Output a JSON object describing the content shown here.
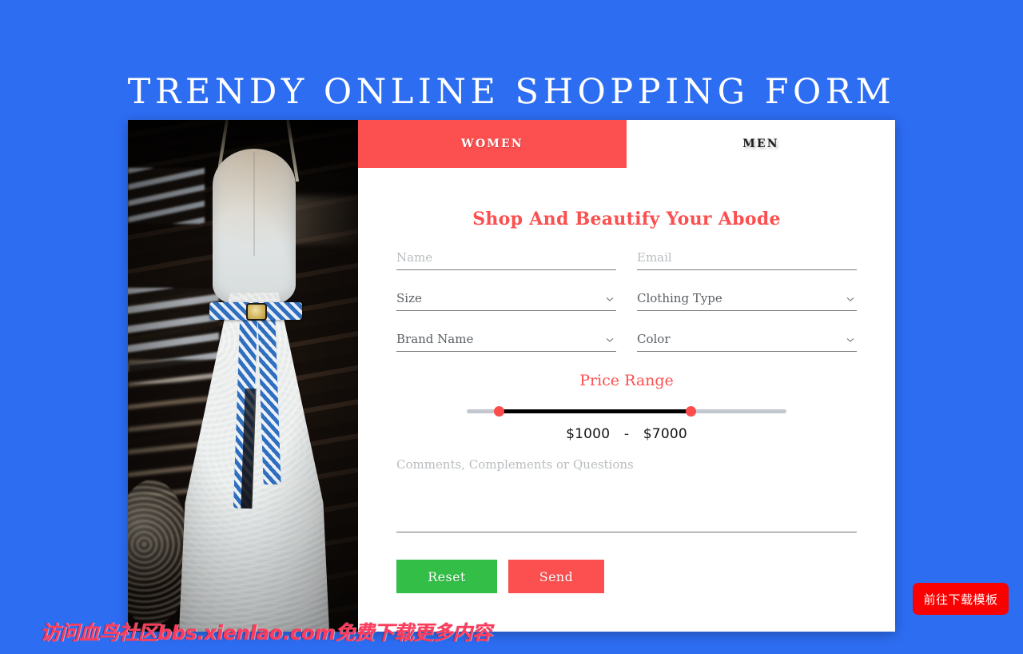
{
  "page": {
    "title": "TRENDY ONLINE SHOPPING FORM",
    "background_color": "#2d6df2",
    "accent_red": "#fc4f4f",
    "accent_green": "#32be47"
  },
  "tabs": [
    {
      "label": "WOMEN",
      "active": true
    },
    {
      "label": "MEN",
      "active": false
    }
  ],
  "photo": {
    "alt_name": "white-lace-gown-with-blue-floral-sash"
  },
  "form": {
    "heading": "Shop And Beautify Your Abode",
    "fields": {
      "name": {
        "placeholder": "Name",
        "value": ""
      },
      "email": {
        "placeholder": "Email",
        "value": ""
      },
      "size": {
        "label": "Size",
        "selected": "Size"
      },
      "clothing_type": {
        "label": "Clothing Type",
        "selected": "Clothing Type"
      },
      "brand_name": {
        "label": "Brand Name",
        "selected": "Brand Name"
      },
      "color": {
        "label": "Color",
        "selected": "Color"
      }
    },
    "price_range": {
      "title": "Price Range",
      "min_label": "$1000",
      "separator": "-",
      "max_label": "$7000",
      "min_value": 1000,
      "max_value": 7000,
      "range_start": 0,
      "range_end": 10000,
      "handle_color": "#fb4b4b",
      "active_track_color": "#000000",
      "rail_color": "#c2c8ce"
    },
    "comments": {
      "placeholder": "Comments, Complements or Questions",
      "value": ""
    },
    "buttons": {
      "reset": "Reset",
      "send": "Send"
    }
  },
  "overlay": {
    "watermark": "访问血鸟社区bbs.xienlao.com免费下载更多内容",
    "download_button": "前往下载模板"
  }
}
